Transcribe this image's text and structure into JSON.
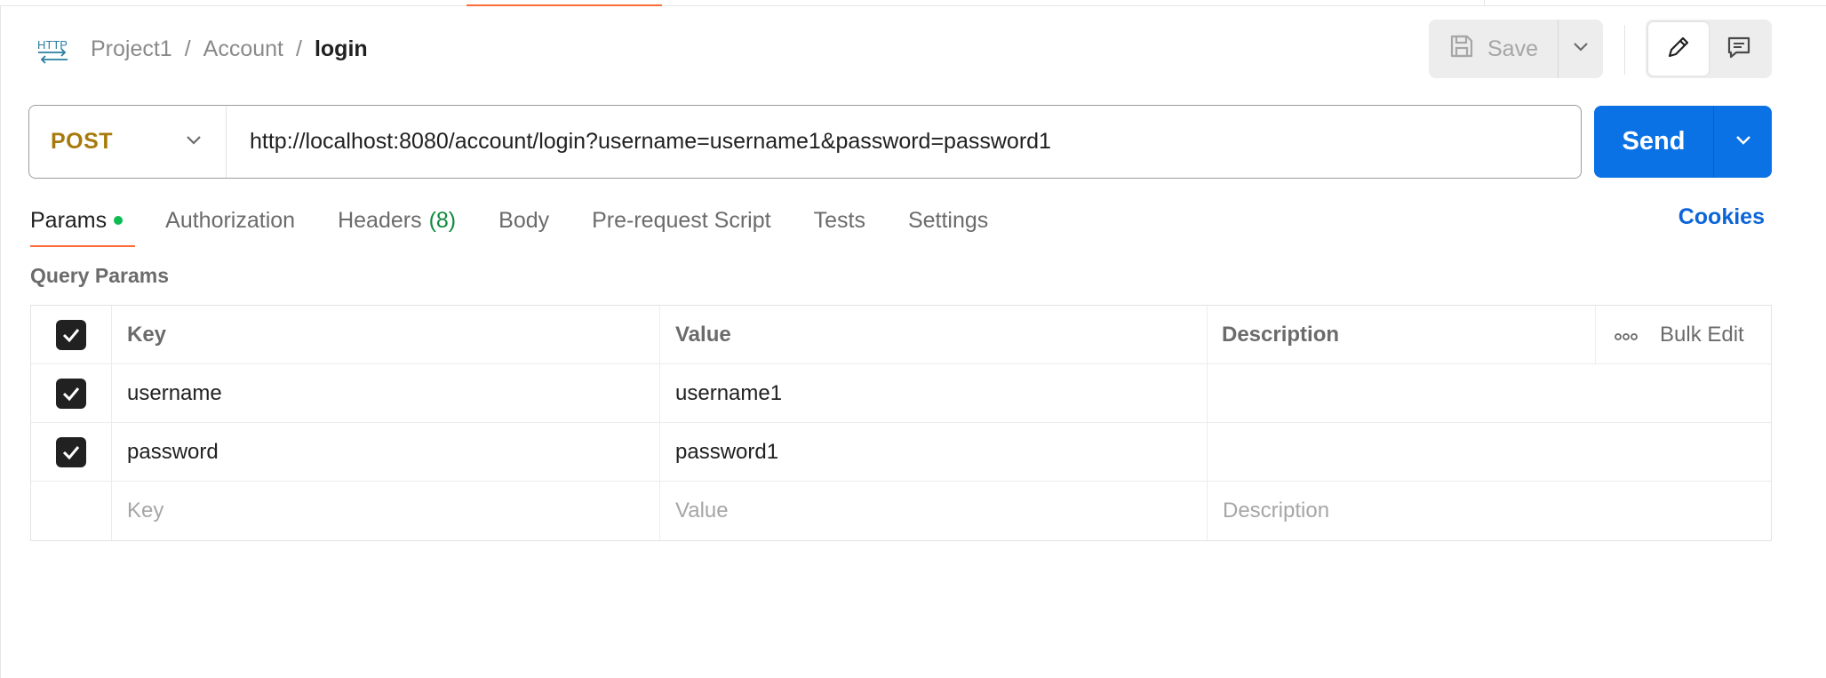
{
  "breadcrumb": {
    "items": [
      "Project1",
      "Account"
    ],
    "separator": "/",
    "current": "login"
  },
  "toolbar": {
    "save_label": "Save"
  },
  "request": {
    "method": "POST",
    "url": "http://localhost:8080/account/login?username=username1&password=password1",
    "send_label": "Send"
  },
  "tabs": [
    {
      "label": "Params",
      "indicator": "dot"
    },
    {
      "label": "Authorization"
    },
    {
      "label": "Headers",
      "count": "(8)"
    },
    {
      "label": "Body"
    },
    {
      "label": "Pre-request Script"
    },
    {
      "label": "Tests"
    },
    {
      "label": "Settings"
    }
  ],
  "cookies_label": "Cookies",
  "query_params": {
    "title": "Query Params",
    "headers": {
      "key": "Key",
      "value": "Value",
      "description": "Description",
      "bulk_edit": "Bulk Edit"
    },
    "rows": [
      {
        "key": "username",
        "value": "username1",
        "description": "",
        "checked": true
      },
      {
        "key": "password",
        "value": "password1",
        "description": "",
        "checked": true
      }
    ],
    "placeholders": {
      "key": "Key",
      "value": "Value",
      "description": "Description"
    }
  },
  "colors": {
    "accent": "#ff6c37",
    "send_blue": "#0b72e5",
    "method_post": "#a87a0e",
    "cookies_link": "#0b65d8",
    "status_dot": "#0cbb52"
  },
  "icons": {
    "request_type": "http-icon",
    "save": "save-icon",
    "edit": "pencil-icon",
    "comments": "comment-icon",
    "more": "more-horizontal-icon"
  }
}
